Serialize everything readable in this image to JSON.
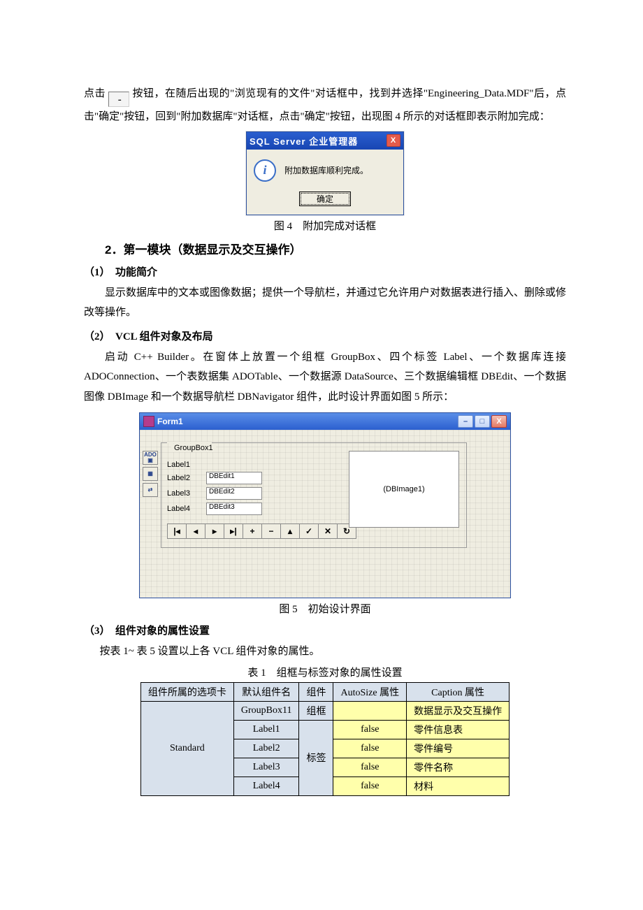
{
  "para1_a": "点击",
  "browse_dots": "...",
  "para1_b": "按钮，在随后出现的\"浏览现有的文件\"对话框中，找到并选择\"Engineering_Data.MDF\"后，点击\"确定\"按钮，回到\"附加数据库\"对话框，点击\"确定\"按钮，出现图 4 所示的对话框即表示附加完成：",
  "dlg1": {
    "title": "SQL Server 企业管理器",
    "msg": "附加数据库顺利完成。",
    "ok": "确定"
  },
  "cap4": "图 4　附加完成对话框",
  "h2": "2．第一模块（数据显示及交互操作）",
  "h3_1": "（1）　功能简介",
  "p_func": "显示数据库中的文本或图像数据；提供一个导航栏，并通过它允许用户对数据表进行插入、删除或修改等操作。",
  "h3_2": "（2）　VCL 组件对象及布局",
  "p_vcl": "启动 C++ Builder。在窗体上放置一个组框 GroupBox、四个标签 Label、一个数据库连接 ADOConnection、一个表数据集 ADOTable、一个数据源 DataSource、三个数据编辑框 DBEdit、一个数据图像 DBImage 和一个数据导航栏 DBNavigator 组件，此时设计界面如图 5 所示：",
  "form1": {
    "title": "Form1",
    "groupbox": "GroupBox1",
    "labels": [
      "Label1",
      "Label2",
      "Label3",
      "Label4"
    ],
    "dbedits": [
      "DBEdit1",
      "DBEdit2",
      "DBEdit3"
    ],
    "dbimage": "(DBImage1)",
    "nav": [
      "|◂",
      "◂",
      "▸",
      "▸|",
      "+",
      "−",
      "▴",
      "✓",
      "✕",
      "↻"
    ],
    "palette": [
      "ADO",
      "",
      "",
      ""
    ]
  },
  "cap5": "图 5　初始设计界面",
  "h3_3": "（3）　组件对象的属性设置",
  "p_table_intro": "按表 1~ 表 5 设置以上各 VCL 组件对象的属性。",
  "cap_t1": "表 1　组框与标签对象的属性设置",
  "chart_data": {
    "type": "table",
    "headers": [
      "组件所属的选项卡",
      "默认组件名",
      "组件",
      "AutoSize 属性",
      "Caption 属性"
    ],
    "rows": [
      {
        "tab": "Standard",
        "name": "GroupBox11",
        "comp": "组框",
        "auto": "",
        "cap": "数据显示及交互操作"
      },
      {
        "tab": "Standard",
        "name": "Label1",
        "comp": "标签",
        "auto": "false",
        "cap": "零件信息表"
      },
      {
        "tab": "Standard",
        "name": "Label2",
        "comp": "标签",
        "auto": "false",
        "cap": "零件编号"
      },
      {
        "tab": "Standard",
        "name": "Label3",
        "comp": "标签",
        "auto": "false",
        "cap": "零件名称"
      },
      {
        "tab": "Standard",
        "name": "Label4",
        "comp": "标签",
        "auto": "false",
        "cap": "材料"
      }
    ],
    "tab_merged_value": "Standard",
    "comp_merge_1": "组框",
    "comp_merge_2": "标签"
  }
}
